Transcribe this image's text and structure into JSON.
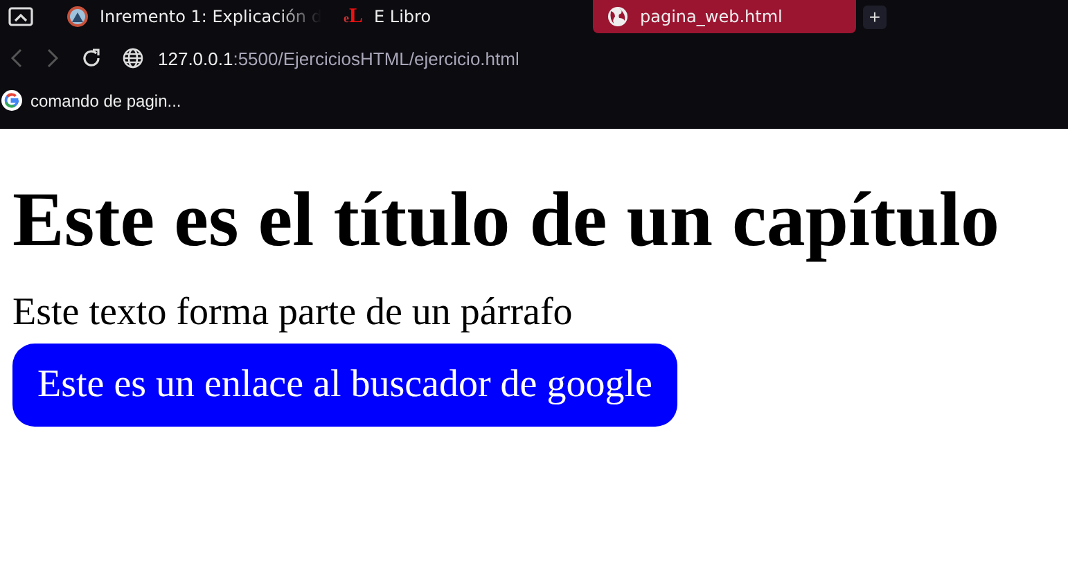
{
  "tabs": [
    {
      "title": "Inremento 1: Explicación d",
      "selected": false,
      "kind": "avatar"
    },
    {
      "title": "E Libro",
      "selected": false,
      "kind": "logo",
      "logo_text": [
        "e",
        "L"
      ]
    },
    {
      "title": "pagina_web.html",
      "selected": true,
      "kind": "globe"
    }
  ],
  "new_tab": "+",
  "address": {
    "host": "127.0.0.1",
    "rest": ":5500/EjerciciosHTML/ejercicio.html"
  },
  "bookmarks": [
    {
      "label": "comando de pagin..."
    }
  ],
  "page": {
    "heading": "Este es el título de un capítulo",
    "paragraph": "Este texto forma parte de un párrafo",
    "link": "Este es un enlace al buscador de google"
  }
}
